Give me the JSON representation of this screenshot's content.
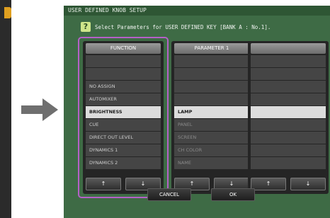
{
  "dialog": {
    "title": "USER DEFINED KNOB SETUP",
    "help_label": "?",
    "instruction": "Select Parameters for USER DEFINED KEY [BANK A : No.1]."
  },
  "columns": [
    {
      "header": "FUNCTION",
      "rows": [
        "",
        "",
        "NO ASSIGN",
        "AUTOMIXER",
        "BRIGHTNESS",
        "CUE",
        "DIRECT OUT LEVEL",
        "DYNAMICS 1",
        "DYNAMICS 2"
      ],
      "selected_index": 4,
      "up_label": "↑",
      "down_label": "↓"
    },
    {
      "header": "PARAMETER 1",
      "rows": [
        "",
        "",
        "",
        "",
        "LAMP",
        "PANEL",
        "SCREEN",
        "CH COLOR",
        "NAME"
      ],
      "selected_index": 4,
      "up_label": "↑",
      "down_label": "↓"
    },
    {
      "header": "",
      "rows": [
        "",
        "",
        "",
        "",
        "",
        "",
        "",
        "",
        ""
      ],
      "selected_index": 4,
      "up_label": "↑",
      "down_label": "↓"
    }
  ],
  "buttons": {
    "cancel": "CANCEL",
    "ok": "OK"
  },
  "colors": {
    "dialog_bg": "#3e6b45",
    "highlight_border": "#b560c8",
    "selected_row": "#dcdcdc"
  }
}
